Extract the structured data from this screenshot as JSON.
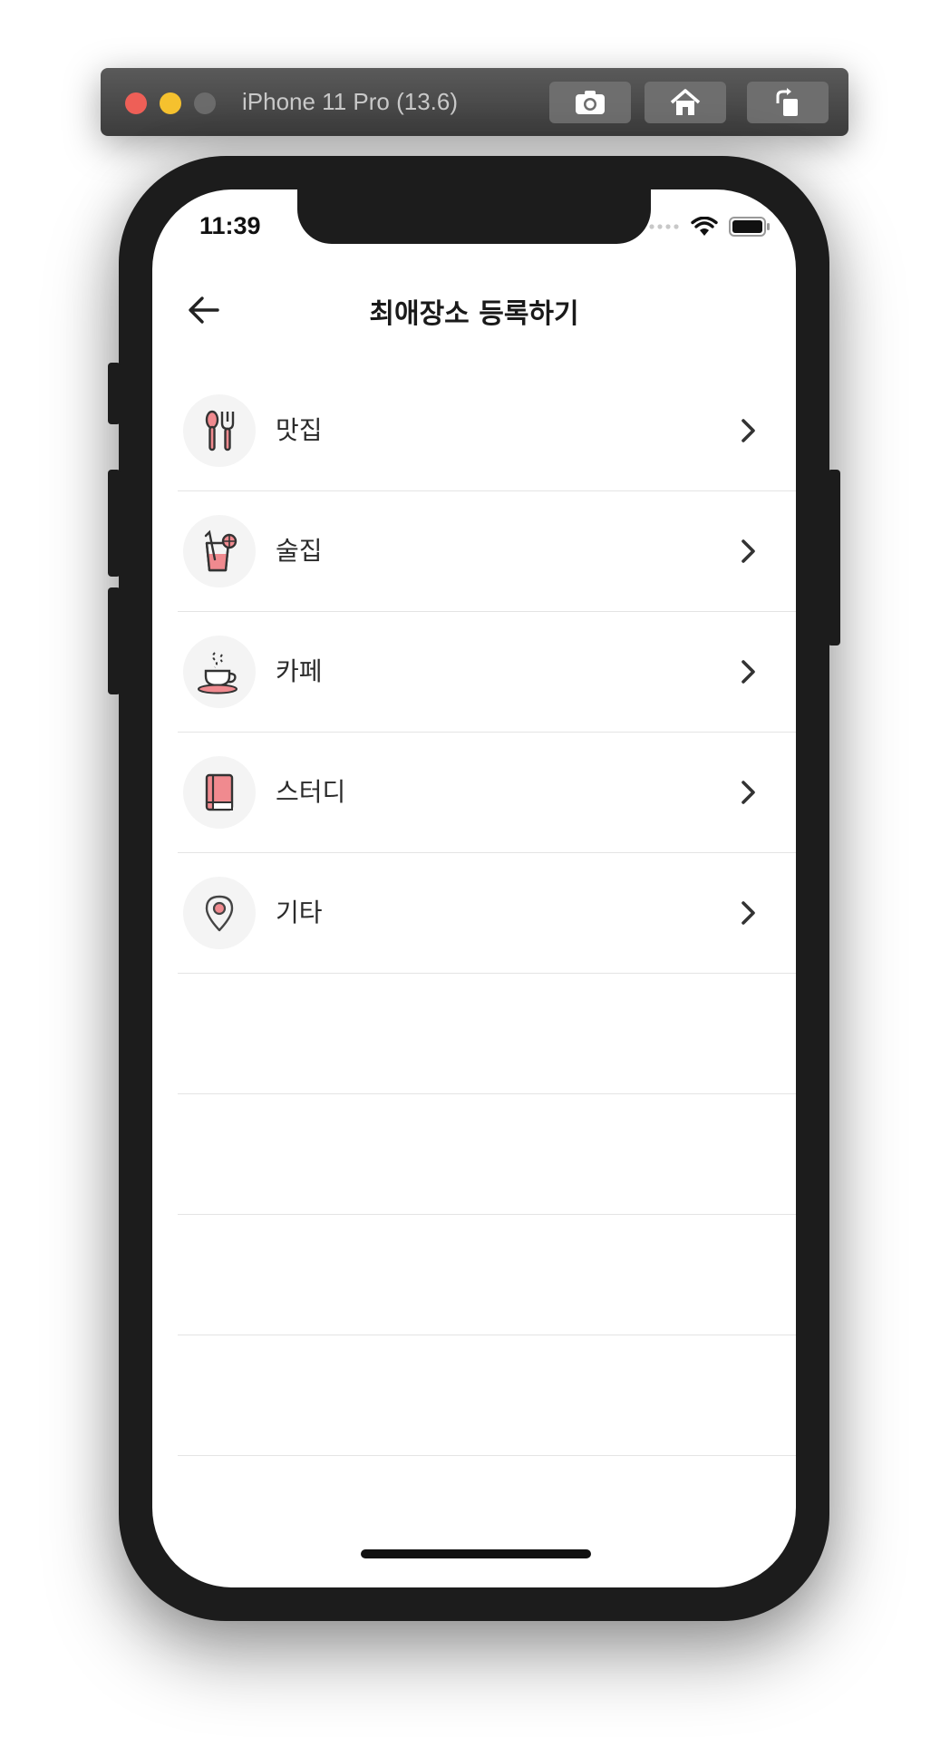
{
  "simulator": {
    "title": "iPhone 11 Pro (13.6)",
    "buttons": [
      "screenshot-icon",
      "home-icon",
      "rotate-icon"
    ]
  },
  "status_bar": {
    "time": "11:39"
  },
  "nav": {
    "title": "최애장소 등록하기",
    "back_icon": "arrow-left-icon"
  },
  "categories": [
    {
      "label": "맛집",
      "icon": "fork-spoon-icon"
    },
    {
      "label": "술집",
      "icon": "drink-icon"
    },
    {
      "label": "카페",
      "icon": "coffee-cup-icon"
    },
    {
      "label": "스터디",
      "icon": "book-icon"
    },
    {
      "label": "기타",
      "icon": "location-pin-icon"
    }
  ],
  "colors": {
    "accent_pink": "#f08a8f",
    "icon_stroke": "#3a3a3a",
    "icon_bg": "#f4f4f4",
    "divider": "#e4e4e4"
  }
}
